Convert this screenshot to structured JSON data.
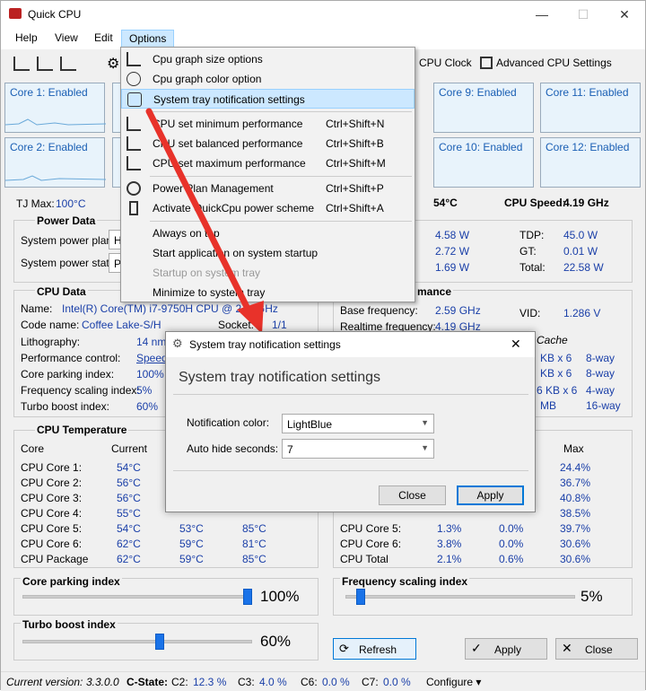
{
  "window": {
    "title": "Quick CPU",
    "minimize": "—",
    "maximize": "☐",
    "close": "✕"
  },
  "menu": [
    "Help",
    "View",
    "Edit",
    "Options"
  ],
  "toolbar": {
    "cpu_clock": "CPU Clock",
    "advanced": "Advanced CPU Settings"
  },
  "cores": [
    {
      "label": "Core 1: Enabled"
    },
    {
      "label": "Core 9: Enabled"
    },
    {
      "label": "Core 11: Enabled"
    },
    {
      "label": "Core 2: Enabled"
    },
    {
      "label": "Core 10: Enabled"
    },
    {
      "label": "Core 12: Enabled"
    }
  ],
  "tj": {
    "label": "TJ Max:",
    "value": "100°C",
    "temp": "54°C",
    "speed_label": "CPU Speed:",
    "speed_value": "4.19 GHz"
  },
  "power": {
    "title": "Power Data",
    "plan_label": "System power plan:",
    "plan_value": "Hi",
    "state_label": "System power state:",
    "state_value": "Pl",
    "w1": "4.58 W",
    "w2": "2.72 W",
    "w3": "1.69 W",
    "tdp_label": "TDP:",
    "tdp": "45.0 W",
    "gt_label": "GT:",
    "gt": "0.01 W",
    "total_label": "Total:",
    "total": "22.58 W"
  },
  "cpu_data": {
    "title": "CPU Data",
    "name_label": "Name:",
    "name": "Intel(R) Core(TM) i7-9750H CPU @ 2.60GHz",
    "code_label": "Code name:",
    "code": "Coffee Lake-S/H",
    "socket_label": "Socket:",
    "socket": "1/1",
    "litho_label": "Lithography:",
    "litho": "14 nm",
    "perf_label": "Performance control:",
    "perf": "Speed",
    "park_label": "Core parking index:",
    "park": "100%",
    "freq_label": "Frequency scaling index:",
    "freq": "5%",
    "turbo_label": "Turbo boost index:",
    "turbo": "60%",
    "perf_title": "mance",
    "base_label": "Base frequency:",
    "base": "2.59 GHz",
    "real_label": "Realtime frequency:",
    "real": "4.19 GHz",
    "vid_label": "VID:",
    "vid": "1.286 V",
    "cache_title": "Cache",
    "cache": [
      [
        "KB x 6",
        "8-way"
      ],
      [
        "KB x 6",
        "8-way"
      ],
      [
        "6 KB x 6",
        "4-way"
      ],
      [
        "MB",
        "16-way"
      ]
    ]
  },
  "temps": {
    "title": "CPU Temperature",
    "h_core": "Core",
    "h_current": "Current",
    "h_max": "Max",
    "rows": [
      {
        "core": "CPU Core 1:",
        "cur": "54°C",
        "min": "",
        "max": ""
      },
      {
        "core": "CPU Core 2:",
        "cur": "56°C",
        "min": "",
        "max": ""
      },
      {
        "core": "CPU Core 3:",
        "cur": "56°C",
        "min": "",
        "max": ""
      },
      {
        "core": "CPU Core 4:",
        "cur": "55°C",
        "min": "",
        "max": ""
      },
      {
        "core": "CPU Core 5:",
        "cur": "54°C",
        "min": "53°C",
        "max": "85°C"
      },
      {
        "core": "CPU Core 6:",
        "cur": "62°C",
        "min": "59°C",
        "max": "81°C"
      },
      {
        "core": "CPU Package",
        "cur": "62°C",
        "min": "59°C",
        "max": "85°C"
      }
    ]
  },
  "util": {
    "max": [
      "24.4%",
      "36.7%",
      "40.8%",
      "38.5%"
    ],
    "rows": [
      {
        "core": "CPU Core 5:",
        "a": "1.3%",
        "b": "0.0%",
        "c": "39.7%"
      },
      {
        "core": "CPU Core 6:",
        "a": "3.8%",
        "b": "0.0%",
        "c": "30.6%"
      },
      {
        "core": "CPU Total",
        "a": "2.1%",
        "b": "0.6%",
        "c": "30.6%"
      }
    ]
  },
  "sliders": {
    "park_label": "Core parking index",
    "park_value": "100%",
    "park_frac": 1.0,
    "freq_label": "Frequency scaling index",
    "freq_value": "5%",
    "freq_frac": 0.05,
    "turbo_label": "Turbo boost index",
    "turbo_value": "60%",
    "turbo_frac": 0.6
  },
  "buttons": {
    "refresh": "Refresh",
    "apply": "Apply",
    "close": "Close"
  },
  "status": {
    "version_label": "Current version:",
    "version": "3.3.0.0",
    "cstate_label": "C-State:",
    "c2_label": "C2:",
    "c2": "12.3 %",
    "c3_label": "C3:",
    "c3": "4.0 %",
    "c6_label": "C6:",
    "c6": "0.0 %",
    "c7_label": "C7:",
    "c7": "0.0 %",
    "configure": "Configure ▾"
  },
  "dropdown": [
    {
      "label": "Cpu graph size options",
      "shortcut": ""
    },
    {
      "label": "Cpu graph color option",
      "shortcut": ""
    },
    {
      "label": "System tray notification settings",
      "shortcut": ""
    },
    {
      "label": "CPU set minimum performance",
      "shortcut": "Ctrl+Shift+N"
    },
    {
      "label": "CPU set balanced performance",
      "shortcut": "Ctrl+Shift+B"
    },
    {
      "label": "CPU set maximum performance",
      "shortcut": "Ctrl+Shift+M"
    },
    {
      "label": "Power Plan Management",
      "shortcut": "Ctrl+Shift+P"
    },
    {
      "label": "Activate QuickCpu power scheme",
      "shortcut": "Ctrl+Shift+A"
    },
    {
      "label": "Always on top",
      "shortcut": ""
    },
    {
      "label": "Start application on system startup",
      "shortcut": ""
    },
    {
      "label": "Startup on system tray",
      "shortcut": ""
    },
    {
      "label": "Minimize to system tray",
      "shortcut": ""
    }
  ],
  "dialog": {
    "title": "System tray notification settings",
    "heading": "System tray notification settings",
    "color_label": "Notification color:",
    "color_value": "LightBlue",
    "hide_label": "Auto hide seconds:",
    "hide_value": "7",
    "close": "Close",
    "apply": "Apply"
  },
  "colors": {
    "accent": "#1a73e8",
    "arrow": "#e8322a",
    "highlight": "#cce8ff"
  }
}
